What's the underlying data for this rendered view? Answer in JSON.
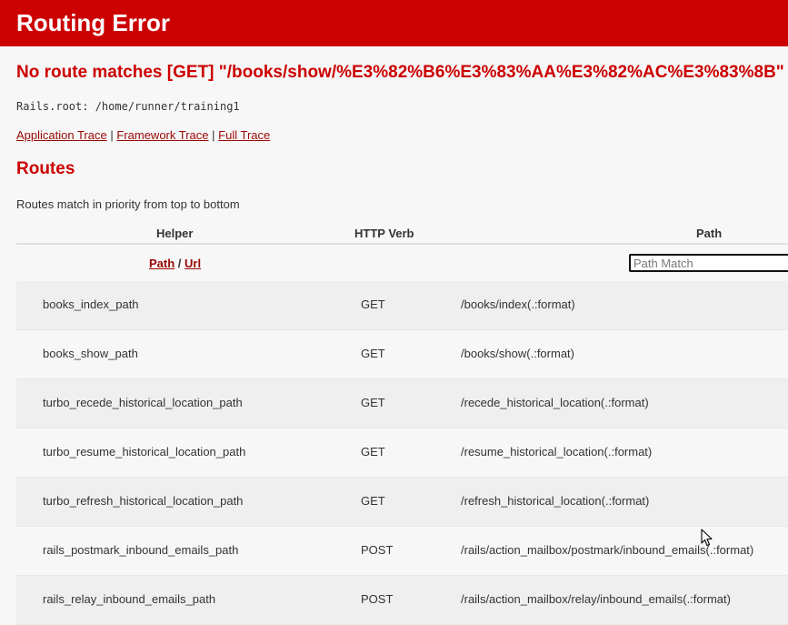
{
  "header": {
    "title": "Routing Error"
  },
  "error": {
    "message": "No route matches [GET] \"/books/show/%E3%82%B6%E3%83%AA%E3%82%AC%E3%83%8B\""
  },
  "rails_root": {
    "text": "Rails.root: /home/runner/training1"
  },
  "traces": {
    "application": "Application Trace",
    "framework": "Framework Trace",
    "full": "Full Trace",
    "separator": "|"
  },
  "routes": {
    "title": "Routes",
    "description": "Routes match in priority from top to bottom",
    "columns": {
      "helper": "Helper",
      "verb": "HTTP Verb",
      "path": "Path"
    },
    "filter": {
      "path_label": "Path",
      "separator": "/",
      "url_label": "Url",
      "search_placeholder": "Path Match"
    },
    "rows": [
      {
        "helper": "books_index_path",
        "verb": "GET",
        "path": "/books/index(.:format)"
      },
      {
        "helper": "books_show_path",
        "verb": "GET",
        "path": "/books/show(.:format)"
      },
      {
        "helper": "turbo_recede_historical_location_path",
        "verb": "GET",
        "path": "/recede_historical_location(.:format)"
      },
      {
        "helper": "turbo_resume_historical_location_path",
        "verb": "GET",
        "path": "/resume_historical_location(.:format)"
      },
      {
        "helper": "turbo_refresh_historical_location_path",
        "verb": "GET",
        "path": "/refresh_historical_location(.:format)"
      },
      {
        "helper": "rails_postmark_inbound_emails_path",
        "verb": "POST",
        "path": "/rails/action_mailbox/postmark/inbound_emails(.:format)"
      },
      {
        "helper": "rails_relay_inbound_emails_path",
        "verb": "POST",
        "path": "/rails/action_mailbox/relay/inbound_emails(.:format)"
      }
    ]
  },
  "colors": {
    "header_bg": "#cc0000",
    "error_text": "#cc0000",
    "link": "#980905",
    "page_bg": "#f7f7f7",
    "row_alt_bg": "#efefef"
  },
  "icons": {
    "cursor": "mouse-pointer-icon"
  }
}
